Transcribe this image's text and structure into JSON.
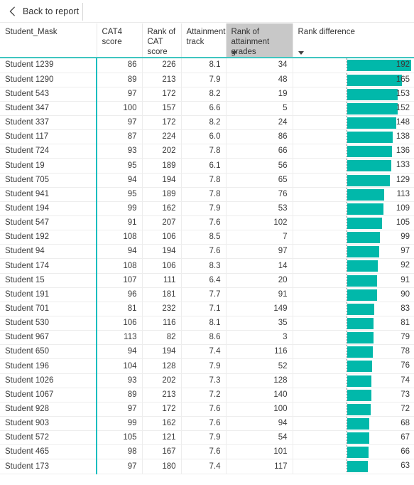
{
  "topbar": {
    "back_label": "Back to report",
    "back_icon": "chevron-left-icon"
  },
  "theme": {
    "bar_color": "#01B8AA",
    "accent_rule": "#3FC6C0",
    "name_column_divider": "#19BEC0",
    "sorted_header_bg": "#C8C8C8",
    "text_color": "#333333"
  },
  "table": {
    "columns": [
      {
        "key": "student_mask",
        "label": "Student_Mask",
        "align": "left",
        "sorted": false,
        "caret": false
      },
      {
        "key": "cat4_score",
        "label": "CAT4 score",
        "align": "right",
        "sorted": false,
        "caret": false
      },
      {
        "key": "rank_cat",
        "label": "Rank of\nCAT score",
        "align": "right",
        "sorted": false,
        "caret": false
      },
      {
        "key": "attain_track",
        "label": "Attainment\ntrack",
        "align": "right",
        "sorted": false,
        "caret": false
      },
      {
        "key": "rank_attain",
        "label": "Rank of\nattainment grades",
        "align": "right",
        "sorted": true,
        "caret": true
      },
      {
        "key": "rank_diff",
        "label": "Rank difference",
        "align": "right",
        "sorted": false,
        "caret": true
      }
    ],
    "column_labels_flat": [
      "Student_Mask",
      "CAT4 score",
      "Rank of CAT score",
      "Attainment track",
      "Rank of attainment grades",
      "Rank difference"
    ],
    "sort_column": "Rank of attainment grades",
    "sort_direction": "descending",
    "bar_max": 192,
    "rows": [
      {
        "student_mask": "Student 1239",
        "cat4_score": "86",
        "rank_cat": "226",
        "attain_track": "8.1",
        "rank_attain": "34",
        "rank_diff": "192"
      },
      {
        "student_mask": "Student 1290",
        "cat4_score": "89",
        "rank_cat": "213",
        "attain_track": "7.9",
        "rank_attain": "48",
        "rank_diff": "165"
      },
      {
        "student_mask": "Student 543",
        "cat4_score": "97",
        "rank_cat": "172",
        "attain_track": "8.2",
        "rank_attain": "19",
        "rank_diff": "153"
      },
      {
        "student_mask": "Student 347",
        "cat4_score": "100",
        "rank_cat": "157",
        "attain_track": "6.6",
        "rank_attain": "5",
        "rank_diff": "152"
      },
      {
        "student_mask": "Student 337",
        "cat4_score": "97",
        "rank_cat": "172",
        "attain_track": "8.2",
        "rank_attain": "24",
        "rank_diff": "148"
      },
      {
        "student_mask": "Student 117",
        "cat4_score": "87",
        "rank_cat": "224",
        "attain_track": "6.0",
        "rank_attain": "86",
        "rank_diff": "138"
      },
      {
        "student_mask": "Student 724",
        "cat4_score": "93",
        "rank_cat": "202",
        "attain_track": "7.8",
        "rank_attain": "66",
        "rank_diff": "136"
      },
      {
        "student_mask": "Student 19",
        "cat4_score": "95",
        "rank_cat": "189",
        "attain_track": "6.1",
        "rank_attain": "56",
        "rank_diff": "133"
      },
      {
        "student_mask": "Student 705",
        "cat4_score": "94",
        "rank_cat": "194",
        "attain_track": "7.8",
        "rank_attain": "65",
        "rank_diff": "129"
      },
      {
        "student_mask": "Student 941",
        "cat4_score": "95",
        "rank_cat": "189",
        "attain_track": "7.8",
        "rank_attain": "76",
        "rank_diff": "113"
      },
      {
        "student_mask": "Student 194",
        "cat4_score": "99",
        "rank_cat": "162",
        "attain_track": "7.9",
        "rank_attain": "53",
        "rank_diff": "109"
      },
      {
        "student_mask": "Student 547",
        "cat4_score": "91",
        "rank_cat": "207",
        "attain_track": "7.6",
        "rank_attain": "102",
        "rank_diff": "105"
      },
      {
        "student_mask": "Student 192",
        "cat4_score": "108",
        "rank_cat": "106",
        "attain_track": "8.5",
        "rank_attain": "7",
        "rank_diff": "99"
      },
      {
        "student_mask": "Student 94",
        "cat4_score": "94",
        "rank_cat": "194",
        "attain_track": "7.6",
        "rank_attain": "97",
        "rank_diff": "97"
      },
      {
        "student_mask": "Student 174",
        "cat4_score": "108",
        "rank_cat": "106",
        "attain_track": "8.3",
        "rank_attain": "14",
        "rank_diff": "92"
      },
      {
        "student_mask": "Student 15",
        "cat4_score": "107",
        "rank_cat": "111",
        "attain_track": "6.4",
        "rank_attain": "20",
        "rank_diff": "91"
      },
      {
        "student_mask": "Student 191",
        "cat4_score": "96",
        "rank_cat": "181",
        "attain_track": "7.7",
        "rank_attain": "91",
        "rank_diff": "90"
      },
      {
        "student_mask": "Student 701",
        "cat4_score": "81",
        "rank_cat": "232",
        "attain_track": "7.1",
        "rank_attain": "149",
        "rank_diff": "83"
      },
      {
        "student_mask": "Student 530",
        "cat4_score": "106",
        "rank_cat": "116",
        "attain_track": "8.1",
        "rank_attain": "35",
        "rank_diff": "81"
      },
      {
        "student_mask": "Student 967",
        "cat4_score": "113",
        "rank_cat": "82",
        "attain_track": "8.6",
        "rank_attain": "3",
        "rank_diff": "79"
      },
      {
        "student_mask": "Student 650",
        "cat4_score": "94",
        "rank_cat": "194",
        "attain_track": "7.4",
        "rank_attain": "116",
        "rank_diff": "78"
      },
      {
        "student_mask": "Student 196",
        "cat4_score": "104",
        "rank_cat": "128",
        "attain_track": "7.9",
        "rank_attain": "52",
        "rank_diff": "76"
      },
      {
        "student_mask": "Student 1026",
        "cat4_score": "93",
        "rank_cat": "202",
        "attain_track": "7.3",
        "rank_attain": "128",
        "rank_diff": "74"
      },
      {
        "student_mask": "Student 1067",
        "cat4_score": "89",
        "rank_cat": "213",
        "attain_track": "7.2",
        "rank_attain": "140",
        "rank_diff": "73"
      },
      {
        "student_mask": "Student 928",
        "cat4_score": "97",
        "rank_cat": "172",
        "attain_track": "7.6",
        "rank_attain": "100",
        "rank_diff": "72"
      },
      {
        "student_mask": "Student 903",
        "cat4_score": "99",
        "rank_cat": "162",
        "attain_track": "7.6",
        "rank_attain": "94",
        "rank_diff": "68"
      },
      {
        "student_mask": "Student 572",
        "cat4_score": "105",
        "rank_cat": "121",
        "attain_track": "7.9",
        "rank_attain": "54",
        "rank_diff": "67"
      },
      {
        "student_mask": "Student 465",
        "cat4_score": "98",
        "rank_cat": "167",
        "attain_track": "7.6",
        "rank_attain": "101",
        "rank_diff": "66"
      },
      {
        "student_mask": "Student 173",
        "cat4_score": "97",
        "rank_cat": "180",
        "attain_track": "7.4",
        "rank_attain": "117",
        "rank_diff": "63"
      }
    ]
  }
}
